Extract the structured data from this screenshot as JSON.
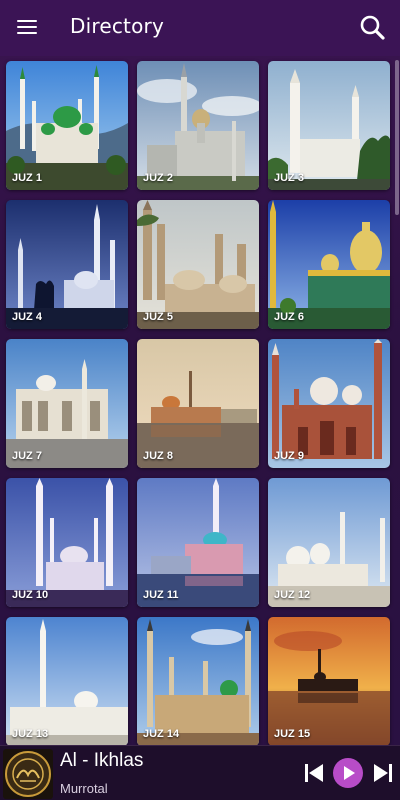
{
  "header": {
    "title": "Directory",
    "menu_icon": "hamburger-menu-icon",
    "search_icon": "search-icon"
  },
  "grid": {
    "items": [
      {
        "label": "JUZ 1"
      },
      {
        "label": "JUZ 2"
      },
      {
        "label": "JUZ 3"
      },
      {
        "label": "JUZ 4"
      },
      {
        "label": "JUZ 5"
      },
      {
        "label": "JUZ 6"
      },
      {
        "label": "JUZ 7"
      },
      {
        "label": "JUZ 8"
      },
      {
        "label": "JUZ 9"
      },
      {
        "label": "JUZ 10"
      },
      {
        "label": "JUZ 11"
      },
      {
        "label": "JUZ 12"
      },
      {
        "label": "JUZ 13"
      },
      {
        "label": "JUZ 14"
      },
      {
        "label": "JUZ 15"
      }
    ]
  },
  "player": {
    "title": "Al - Ikhlas",
    "subtitle": "Murrotal",
    "accent": "#b84cc8"
  },
  "colors": {
    "appbar": "#3b1455",
    "background": "#2b1140",
    "player_bg": "#1e0e2b"
  }
}
